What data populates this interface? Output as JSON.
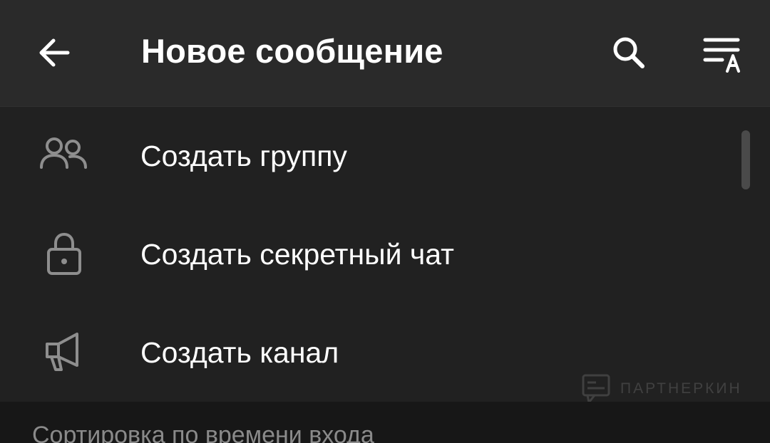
{
  "toolbar": {
    "title": "Новое сообщение",
    "back_icon": "arrow-left-icon",
    "search_icon": "search-icon",
    "sort_icon": "sort-alpha-icon"
  },
  "menu": {
    "items": [
      {
        "label": "Создать группу",
        "icon": "group-icon"
      },
      {
        "label": "Создать секретный чат",
        "icon": "lock-icon"
      },
      {
        "label": "Создать канал",
        "icon": "megaphone-icon"
      }
    ]
  },
  "section": {
    "title": "Сортировка по времени входа"
  },
  "watermark": {
    "text": "ПАРТНЕРКИН"
  },
  "colors": {
    "toolbar_bg": "#2a2a2a",
    "background": "#212121",
    "section_bg": "#171717",
    "icon_gray": "#8e8e8e",
    "text": "#ffffff"
  }
}
